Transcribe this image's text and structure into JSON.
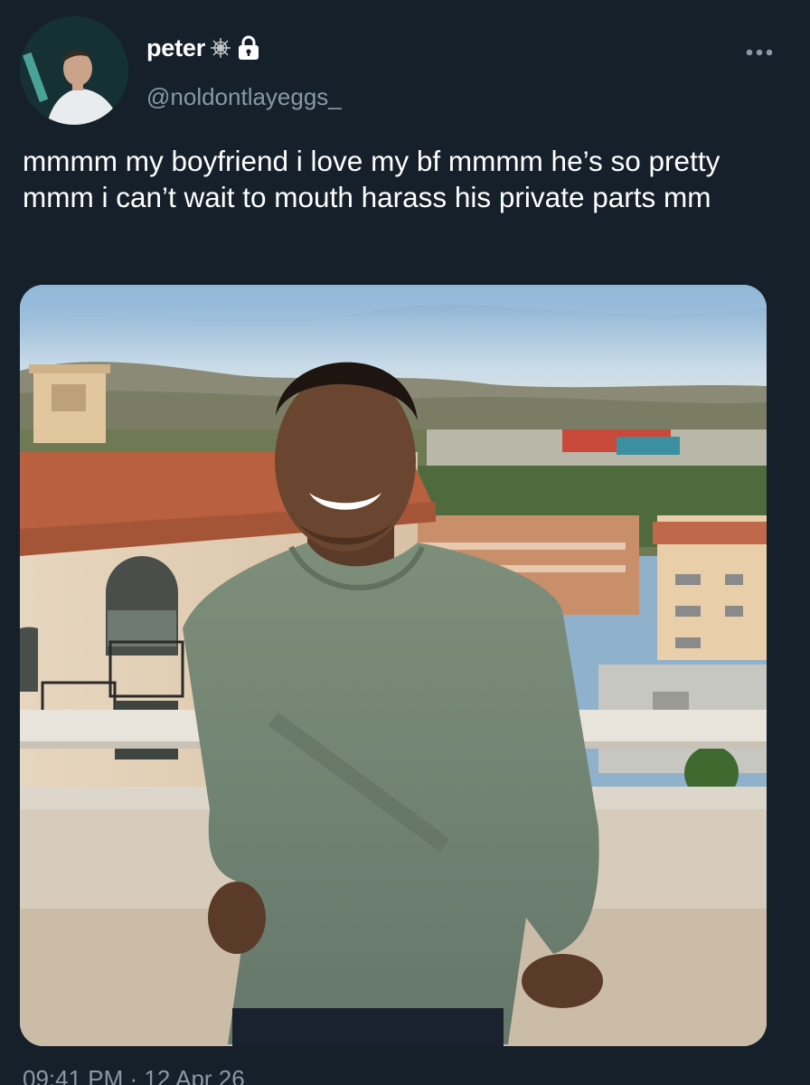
{
  "tweet": {
    "display_name": "peter",
    "handle": "@noldontlayeggs_",
    "text": "mmmm my boyfriend i love my bf mmmm he’s so pretty mmm i can’t wait to mouth harass his private parts mm",
    "timestamp": "09:41 PM · 12 Apr 26",
    "icons": {
      "name_badge": "spider-web-icon",
      "protected": "lock-icon",
      "more": "more-horizontal-icon"
    },
    "media": {
      "type": "photo",
      "subject": "smiling man in green sweater on rooftop balcony overlooking city"
    }
  },
  "colors": {
    "background": "#15202b",
    "text_primary": "#ffffff",
    "text_secondary": "#8899a6"
  }
}
